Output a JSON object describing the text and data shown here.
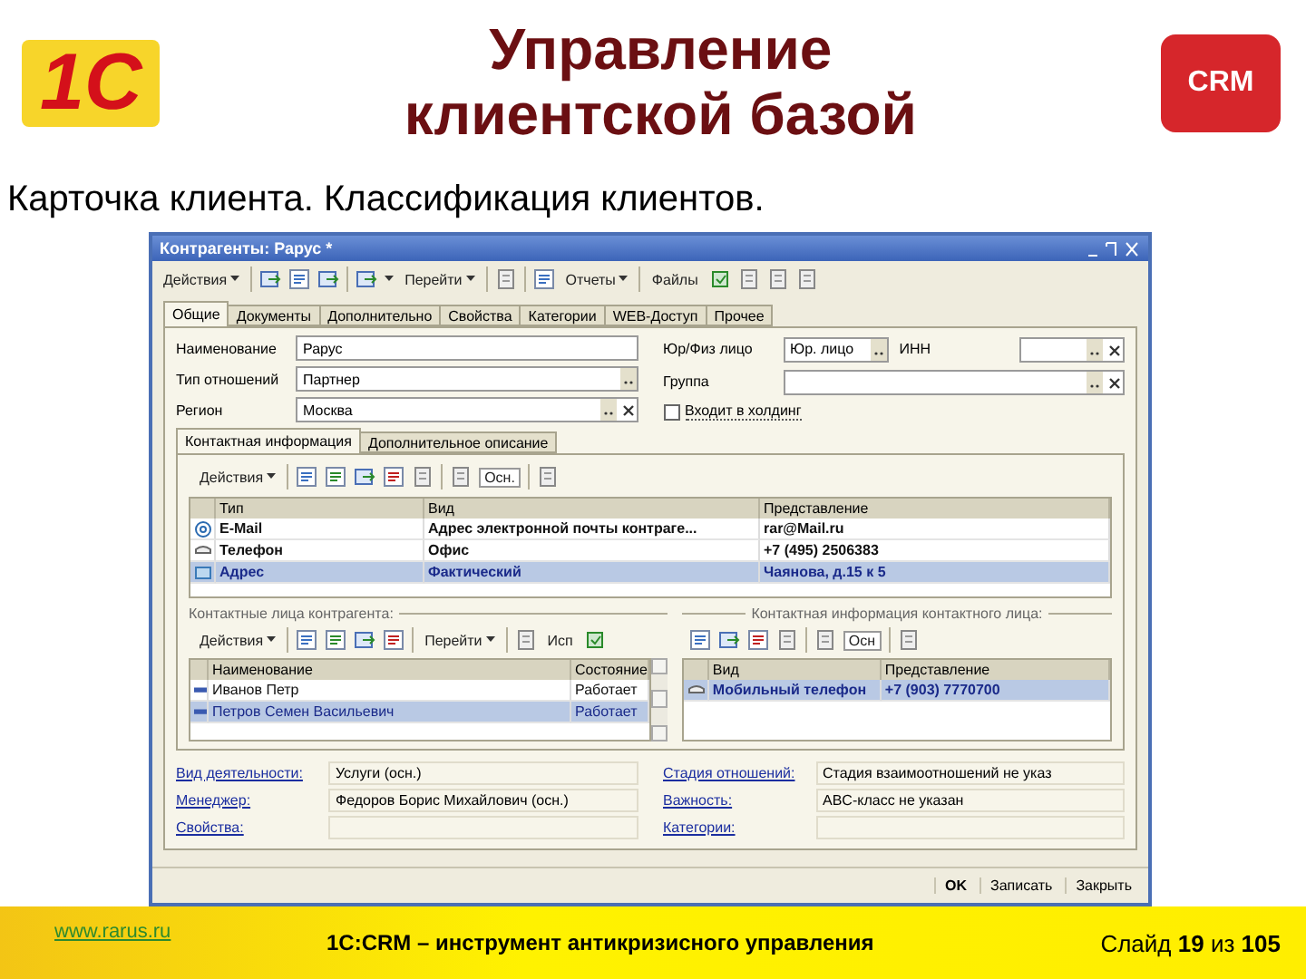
{
  "slide": {
    "logo": "1С",
    "title": "Управление клиентской базой",
    "badge": "CRM",
    "subtitle": "Карточка клиента. Классификация клиентов."
  },
  "window": {
    "title": "Контрагенты: Рарус *"
  },
  "toolbar": {
    "actions": "Действия",
    "goto": "Перейти",
    "reports": "Отчеты",
    "files": "Файлы"
  },
  "tabs": [
    {
      "label": "Общие",
      "selected": true
    },
    {
      "label": "Документы",
      "selected": false
    },
    {
      "label": "Дополнительно",
      "selected": false
    },
    {
      "label": "Свойства",
      "selected": false
    },
    {
      "label": "Категории",
      "selected": false
    },
    {
      "label": "WEB-Доступ",
      "selected": false
    },
    {
      "label": "Прочее",
      "selected": false
    }
  ],
  "fields_left": [
    {
      "label": "Наименование",
      "value": "Рарус",
      "kind": "text"
    },
    {
      "label": "Тип отношений",
      "value": "Партнер",
      "kind": "select"
    },
    {
      "label": "Регион",
      "value": "Москва",
      "kind": "clearable"
    }
  ],
  "fields_right": [
    [
      {
        "label": "Юр/Физ лицо",
        "value": "Юр. лицо",
        "kind": "select"
      },
      {
        "label": "ИНН",
        "kind": "clearable"
      }
    ],
    [
      {
        "label": "Группа",
        "kind": "clearable"
      }
    ]
  ],
  "holding": {
    "label": "Входит в холдинг",
    "checked": false
  },
  "subtabs": [
    {
      "label": "Контактная информация",
      "selected": true
    },
    {
      "label": "Дополнительное описание",
      "selected": false
    }
  ],
  "contact_toolbar": {
    "actions": "Действия",
    "main": "Осн."
  },
  "contact_table": {
    "columns": [
      "Тип",
      "Вид",
      "Представление"
    ],
    "rows": [
      {
        "kind": "email",
        "type": "E-Mail",
        "view": "Адрес электронной почты контраге...",
        "value": "rar@Mail.ru",
        "selected": false
      },
      {
        "kind": "phone",
        "type": "Телефон",
        "view": "Офис",
        "value": "+7 (495) 2506383",
        "selected": false
      },
      {
        "kind": "address",
        "type": "Адрес",
        "view": "Фактический",
        "value": "Чаянова, д.15 к 5",
        "selected": true
      }
    ]
  },
  "persons": {
    "title": "Контактные лица контрагента:",
    "actions": "Действия",
    "goto": "Перейти",
    "use": "Исп",
    "columns": [
      "Наименование",
      "Состояние"
    ],
    "rows": [
      {
        "name": "Иванов Петр",
        "state": "Работает",
        "selected": false
      },
      {
        "name": "Петров Семен Васильевич",
        "state": "Работает",
        "selected": true
      }
    ]
  },
  "person_contacts": {
    "title": "Контактная информация контактного лица:",
    "main": "Осн",
    "columns": [
      "Вид",
      "Представление"
    ],
    "rows": [
      {
        "view": "Мобильный телефон",
        "value": "+7 (903) 7770700",
        "selected": true
      }
    ]
  },
  "bottom_left": [
    {
      "label": "Вид деятельности:",
      "value": "Услуги (осн.)"
    },
    {
      "label": "Менеджер:",
      "value": "Федоров Борис Михайлович (осн.)"
    },
    {
      "label": "Свойства:"
    }
  ],
  "bottom_right": [
    {
      "label": "Стадия отношений:",
      "value": "Стадия взаимоотношений не указ"
    },
    {
      "label": "Важность:",
      "value": "ABC-класс не указан"
    },
    {
      "label": "Категории:"
    }
  ],
  "buttons": [
    {
      "label": "OK",
      "primary": true
    },
    {
      "label": "Записать",
      "primary": false
    },
    {
      "label": "Закрыть",
      "primary": false
    }
  ],
  "footer": {
    "site": "www.rarus.ru",
    "caption": "1С:CRM – инструмент антикризисного управления",
    "page": "Слайд **19** из **105**"
  }
}
